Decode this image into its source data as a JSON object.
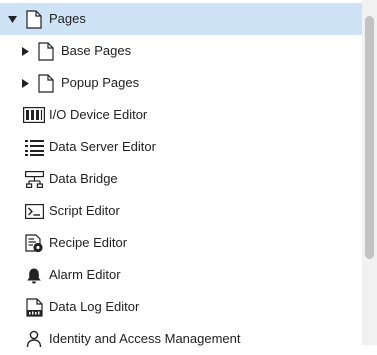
{
  "tree": {
    "items": [
      {
        "label": "Pages",
        "icon": "page-icon",
        "expanded": true,
        "selected": true
      },
      {
        "label": "Base Pages",
        "icon": "page-icon",
        "expanded": false
      },
      {
        "label": "Popup Pages",
        "icon": "page-icon",
        "expanded": false
      },
      {
        "label": "I/O Device Editor",
        "icon": "io-device-icon"
      },
      {
        "label": "Data Server Editor",
        "icon": "data-server-icon"
      },
      {
        "label": "Data Bridge",
        "icon": "data-bridge-icon"
      },
      {
        "label": "Script Editor",
        "icon": "script-icon"
      },
      {
        "label": "Recipe Editor",
        "icon": "recipe-icon"
      },
      {
        "label": "Alarm Editor",
        "icon": "bell-icon"
      },
      {
        "label": "Data Log Editor",
        "icon": "data-log-icon"
      },
      {
        "label": "Identity and Access Management",
        "icon": "user-icon"
      }
    ]
  },
  "colors": {
    "selection": "#cfe3f6",
    "text": "#222222",
    "scrollbar_thumb": "#c3c3c3"
  }
}
